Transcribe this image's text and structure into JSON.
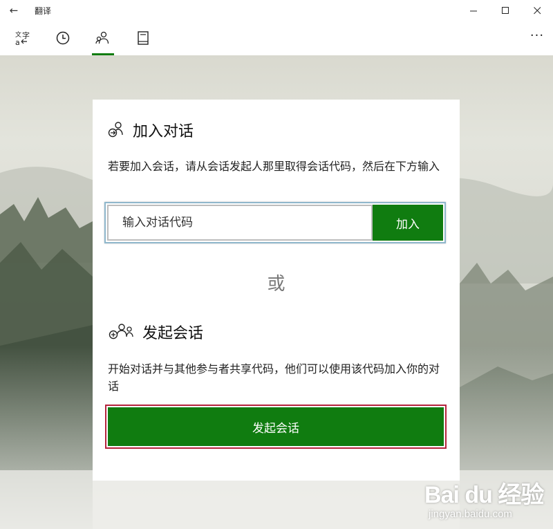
{
  "window": {
    "title": "翻译",
    "back_icon": "←",
    "minimize_icon": "—",
    "maximize_icon": "☐",
    "close_icon": "✕"
  },
  "nav": {
    "tabs": [
      {
        "name": "translate-tab",
        "icon": "translate-icon"
      },
      {
        "name": "history-tab",
        "icon": "clock-icon"
      },
      {
        "name": "conversation-tab",
        "icon": "people-icon",
        "active": true
      },
      {
        "name": "phrasebook-tab",
        "icon": "book-icon"
      }
    ],
    "more_label": "···",
    "accent_color": "#107c10"
  },
  "join": {
    "title": "加入对话",
    "description": "若要加入会话，请从会话发起人那里取得会话代码，然后在下方输入",
    "input_placeholder": "输入对话代码",
    "button_label": "加入"
  },
  "or_label": "或",
  "start": {
    "title": "发起会话",
    "description": "开始对话并与其他参与者共享代码，他们可以使用该代码加入你的对话",
    "button_label": "发起会话"
  },
  "watermark": {
    "main": "Bai du 经验",
    "sub": "jingyan.baidu.com"
  }
}
